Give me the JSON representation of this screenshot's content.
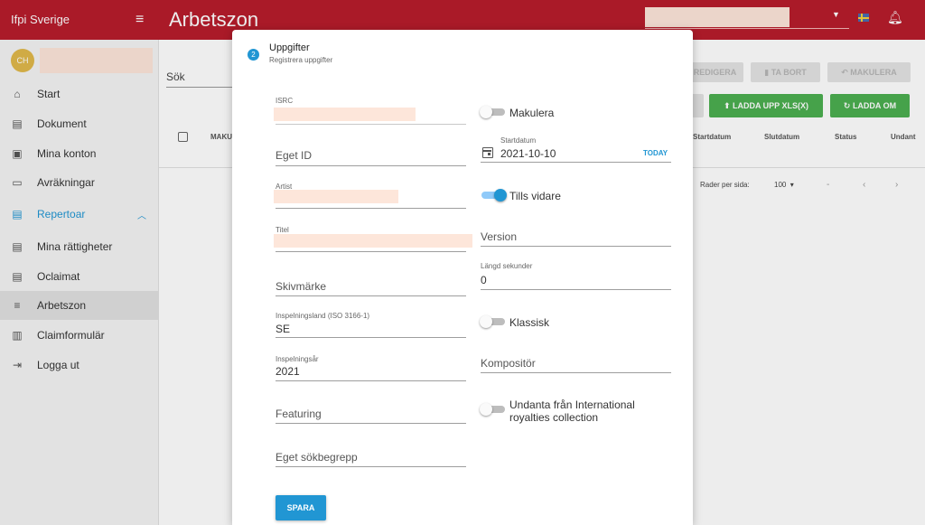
{
  "topbar": {
    "brand": "Ifpi Sverige",
    "title": "Arbetszon"
  },
  "user": {
    "initials": "CH"
  },
  "sidebar": {
    "items": [
      {
        "label": "Start"
      },
      {
        "label": "Dokument"
      },
      {
        "label": "Mina konton"
      },
      {
        "label": "Avräkningar"
      },
      {
        "label": "Repertoar"
      },
      {
        "label": "Mina rättigheter"
      },
      {
        "label": "Oclaimat"
      },
      {
        "label": "Arbetszon"
      },
      {
        "label": "Claimformulär"
      },
      {
        "label": "Logga ut"
      }
    ]
  },
  "main": {
    "search_label": "Sök",
    "col_maku": "MAKU",
    "buttons": {
      "redigera": "REDIGERA",
      "ta_bort": "TA BORT",
      "makulera": "MAKULERA",
      "ladda_upp": "LADDA UPP XLS(X)",
      "ladda_om": "LADDA OM"
    },
    "columns": [
      "Startdatum",
      "Slutdatum",
      "Status",
      "Undant"
    ],
    "rows_per_page_label": "Rader per sida:",
    "rows_per_page_value": "100",
    "pager_range": "-",
    "pager_prev": "‹",
    "pager_next": "›"
  },
  "modal": {
    "step_number": "2",
    "title": "Uppgifter",
    "subtitle": "Registrera uppgifter",
    "fields": {
      "isrc_label": "ISRC",
      "eget_id": "Eget ID",
      "artist_label": "Artist",
      "titel_label": "Titel",
      "skivmarke": "Skivmärke",
      "inspelningsland_label": "Inspelningsland (ISO 3166-1)",
      "inspelningsland_value": "SE",
      "inspelningsar_label": "Inspelningsår",
      "inspelningsar_value": "2021",
      "featuring": "Featuring",
      "eget_sokbegrepp": "Eget sökbegrepp",
      "makulera": "Makulera",
      "startdatum_label": "Startdatum",
      "startdatum_value": "2021-10-10",
      "today": "TODAY",
      "tills_vidare": "Tills vidare",
      "version": "Version",
      "langd_label": "Längd sekunder",
      "langd_value": "0",
      "klassisk": "Klassisk",
      "kompositor": "Kompositör",
      "undanta_line1": "Undanta från International",
      "undanta_line2": "royalties collection"
    },
    "save_label": "SPARA"
  },
  "colors": {
    "topbar": "#b71c2c",
    "accent": "#2196d3",
    "green": "#4caf50",
    "redaction": "#fde6da"
  },
  "toggles": {
    "makulera": false,
    "tills_vidare": true,
    "klassisk": false,
    "undanta": false
  }
}
